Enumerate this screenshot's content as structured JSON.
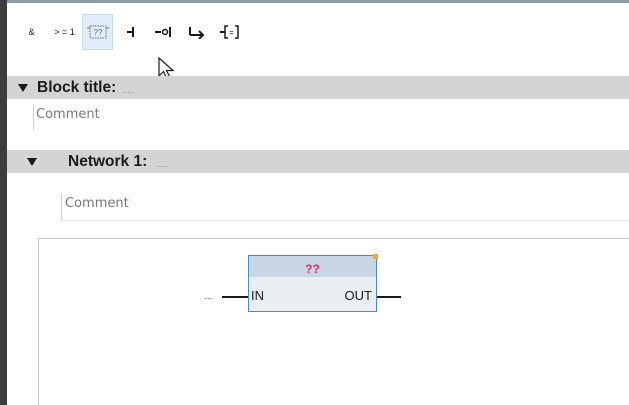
{
  "toolbar": {
    "buttons": [
      {
        "label": "&",
        "icon": "and-box"
      },
      {
        "label": ">=1",
        "icon": "or-box"
      },
      {
        "label": "[??]",
        "icon": "empty-box-icon",
        "active": true
      },
      {
        "label": "",
        "icon": "open-branch-icon"
      },
      {
        "label": "",
        "icon": "negate-icon"
      },
      {
        "label": "",
        "icon": "close-branch-icon"
      },
      {
        "label": "",
        "icon": "assignment-icon"
      }
    ],
    "and_label": "&",
    "or_label": "> = 1",
    "assignment_label": "="
  },
  "block": {
    "title_label": "Block title:",
    "title_placeholder": ".....",
    "comment_placeholder": "Comment"
  },
  "network": {
    "title_label": "Network 1:",
    "title_placeholder": ".....",
    "comment_placeholder": "Comment"
  },
  "box": {
    "name": "??",
    "in_pin": "IN",
    "out_pin": "OUT",
    "in_operand": "...",
    "colors": {
      "name": "#e8256e",
      "border": "#4a8ac9",
      "corner": "#f2a33a"
    }
  }
}
